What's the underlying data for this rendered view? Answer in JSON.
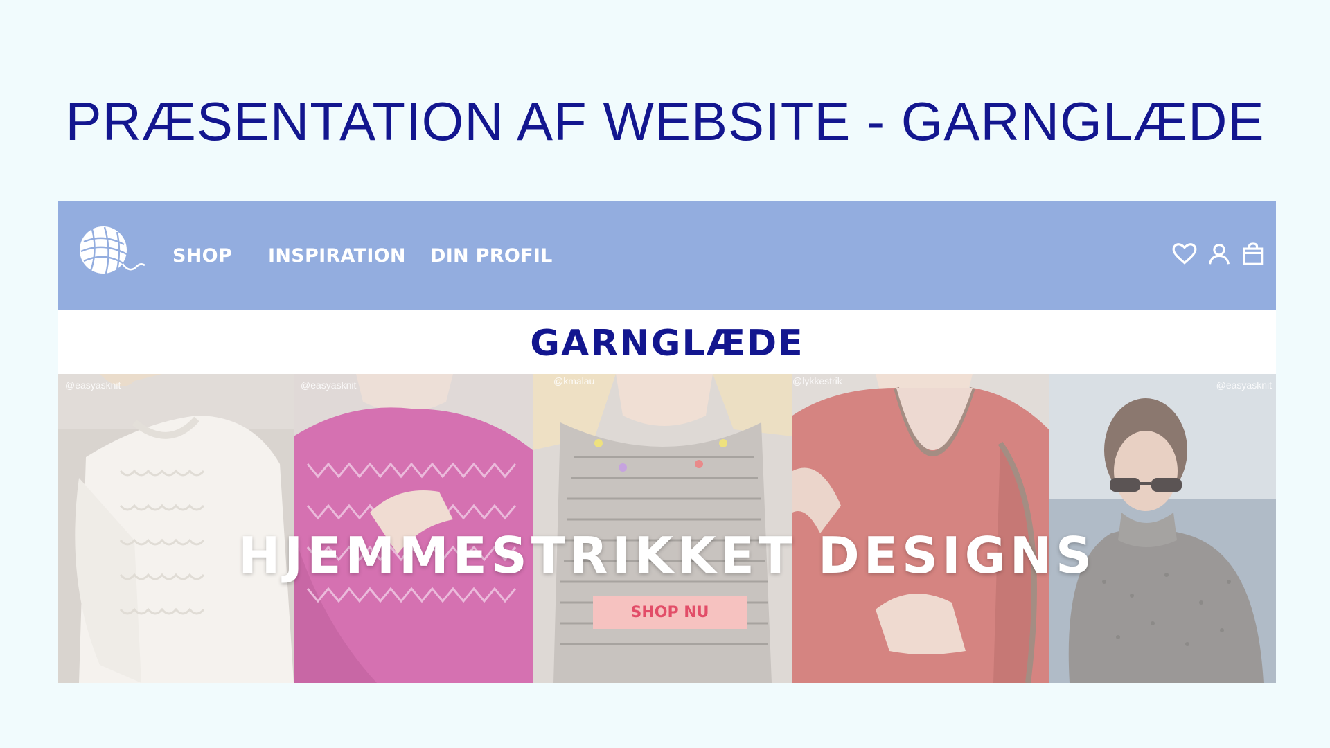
{
  "slide": {
    "title": "PRÆSENTATION AF WEBSITE - GARNGLÆDE"
  },
  "website": {
    "nav": {
      "links": [
        "SHOP",
        "INSPIRATION",
        "DIN PROFIL"
      ],
      "icons": [
        "heart-icon",
        "user-icon",
        "shopping-bag-icon"
      ]
    },
    "brand": "GARNGLÆDE",
    "hero": {
      "headline": "HJEMMESTRIKKET DESIGNS",
      "button": "SHOP NU",
      "credits": [
        "@easyasknit",
        "@easyasknit",
        "@kmalau",
        "@lykkestrik",
        "@easyasknit"
      ]
    },
    "colors": {
      "slide_background": "#f1fbfd",
      "title_blue": "#13168f",
      "nav_background": "#93addf",
      "button_background": "#f6c2c0",
      "button_text": "#e24d68"
    }
  }
}
